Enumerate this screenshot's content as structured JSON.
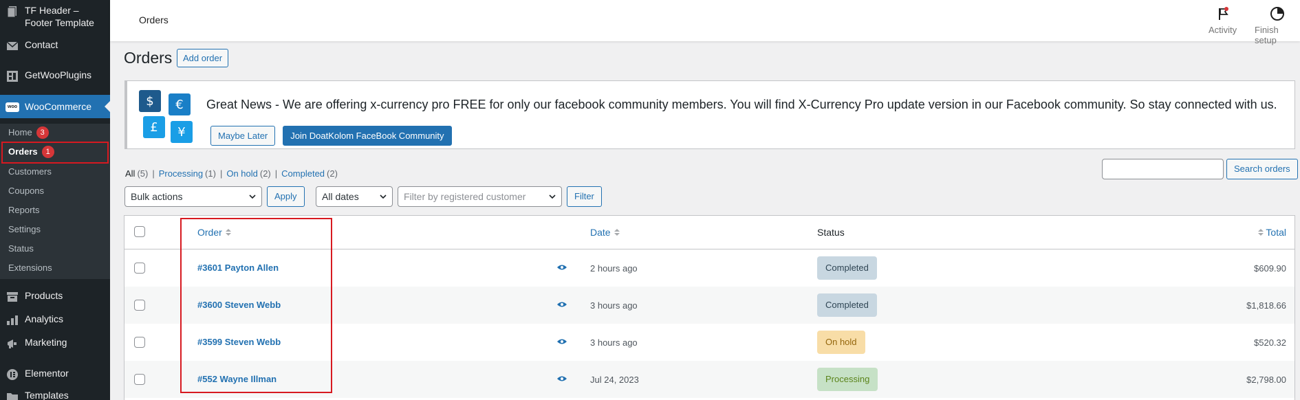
{
  "sidebar": {
    "items": [
      {
        "label": "TF Header – Footer Template",
        "icon": "page-icon"
      },
      {
        "label": "Contact",
        "icon": "mail-icon"
      },
      {
        "label": "GetWooPlugins",
        "icon": "plugin-grid-icon"
      },
      {
        "label": "WooCommerce",
        "icon": "woo-logo-icon",
        "logo_text": "woo"
      },
      {
        "label": "Products",
        "icon": "archive-icon"
      },
      {
        "label": "Analytics",
        "icon": "bar-chart-icon"
      },
      {
        "label": "Marketing",
        "icon": "megaphone-icon"
      },
      {
        "label": "Elementor",
        "icon": "elementor-icon"
      },
      {
        "label": "Templates",
        "icon": "folder-icon"
      }
    ],
    "submenu": [
      {
        "label": "Home",
        "badge": "3"
      },
      {
        "label": "Orders",
        "badge": "1",
        "current": true
      },
      {
        "label": "Customers"
      },
      {
        "label": "Coupons"
      },
      {
        "label": "Reports"
      },
      {
        "label": "Settings"
      },
      {
        "label": "Status"
      },
      {
        "label": "Extensions"
      }
    ]
  },
  "topbar": {
    "title": "Orders",
    "activity_label": "Activity",
    "finish_setup_label": "Finish setup"
  },
  "page": {
    "heading": "Orders",
    "add_order_label": "Add order"
  },
  "notice": {
    "currency_symbols": [
      "$",
      "€",
      "£",
      "¥"
    ],
    "text": "Great News - We are offering x-currency pro FREE for only our facebook community members. You will find X-Currency Pro update version in our Facebook community. So stay connected with us.",
    "maybe_later_label": "Maybe Later",
    "join_label": "Join DoatKolom FaceBook Community",
    "colors": {
      "dark_blue": "#1e5a8c",
      "light_blue": "#1a9ee6"
    }
  },
  "filters": {
    "status_links": [
      {
        "label": "All",
        "count": "(5)",
        "current": true
      },
      {
        "label": "Processing",
        "count": "(1)"
      },
      {
        "label": "On hold",
        "count": "(2)"
      },
      {
        "label": "Completed",
        "count": "(2)"
      }
    ],
    "separator": "|",
    "search_placeholder": "",
    "search_button_label": "Search orders",
    "bulk_actions_value": "Bulk actions",
    "apply_label": "Apply",
    "dates_value": "All dates",
    "customer_placeholder": "Filter by registered customer",
    "filter_label": "Filter"
  },
  "table": {
    "columns": {
      "order": "Order",
      "date": "Date",
      "status": "Status",
      "total": "Total"
    },
    "rows": [
      {
        "order": "#3601 Payton Allen",
        "date": "2 hours ago",
        "status": "Completed",
        "status_key": "completed",
        "total": "$609.90"
      },
      {
        "order": "#3600 Steven Webb",
        "date": "3 hours ago",
        "status": "Completed",
        "status_key": "completed",
        "total": "$1,818.66"
      },
      {
        "order": "#3599 Steven Webb",
        "date": "3 hours ago",
        "status": "On hold",
        "status_key": "on-hold",
        "total": "$520.32"
      },
      {
        "order": "#552 Wayne Illman",
        "date": "Jul 24, 2023",
        "status": "Processing",
        "status_key": "processing",
        "total": "$2,798.00"
      }
    ]
  },
  "colors": {
    "sidebar_bg": "#1d2327",
    "active_menu": "#2271b1",
    "highlight": "#d71920",
    "link": "#2271b1"
  }
}
